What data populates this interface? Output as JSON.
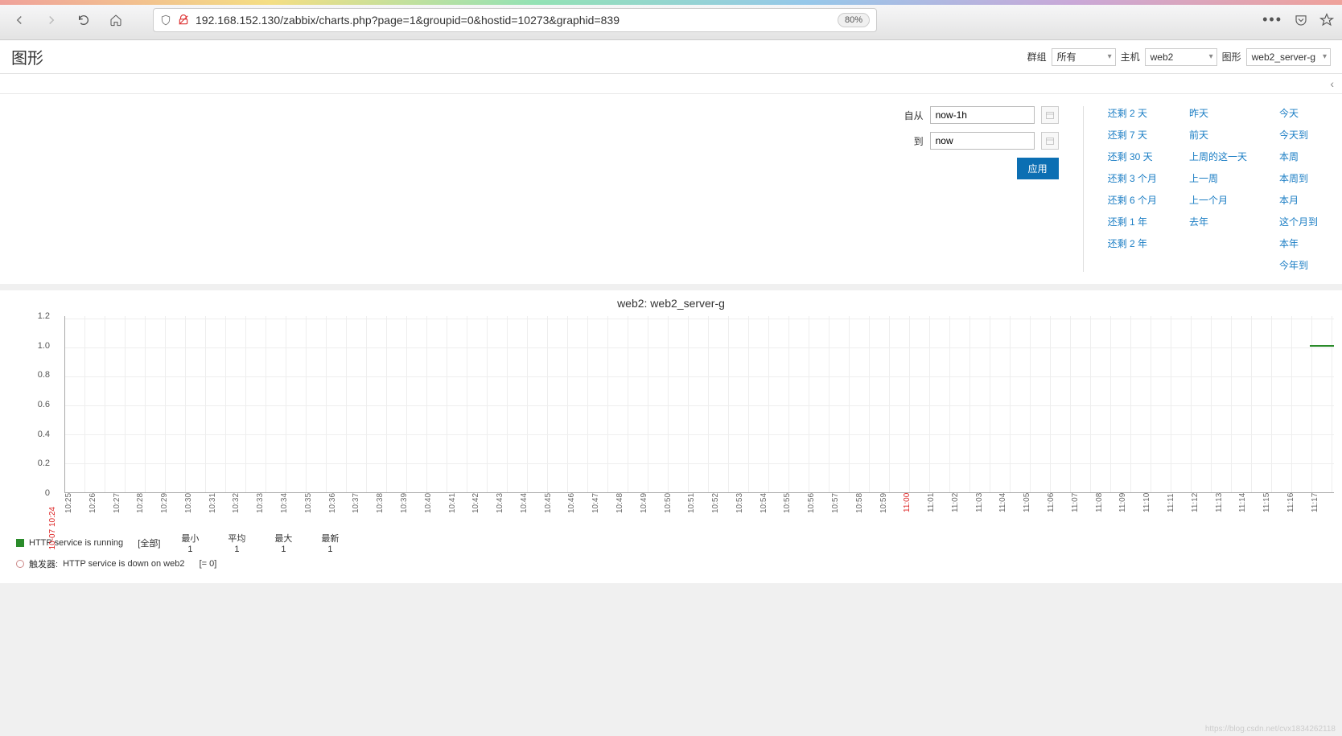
{
  "browser": {
    "url": "192.168.152.130/zabbix/charts.php?page=1&groupid=0&hostid=10273&graphid=839",
    "zoom": "80%"
  },
  "header": {
    "title": "图形",
    "filters": {
      "group_label": "群组",
      "group_value": "所有",
      "host_label": "主机",
      "host_value": "web2",
      "graph_label": "图形",
      "graph_value": "web2_server-g"
    }
  },
  "time": {
    "from_label": "自从",
    "from_value": "now-1h",
    "to_label": "到",
    "to_value": "now",
    "apply_label": "应用",
    "quick": {
      "col1": [
        "还剩 2 天",
        "还剩 7 天",
        "还剩 30 天",
        "还剩 3 个月",
        "还剩 6 个月",
        "还剩 1 年",
        "还剩 2 年"
      ],
      "col2": [
        "昨天",
        "前天",
        "上周的这一天",
        "上一周",
        "上一个月",
        "去年"
      ],
      "col3": [
        "今天",
        "今天到",
        "本周",
        "本周到",
        "本月",
        "这个月到",
        "本年",
        "今年到"
      ]
    }
  },
  "chart_data": {
    "type": "line",
    "title": "web2: web2_server-g",
    "ylabel": "",
    "ylim": [
      0,
      1.2
    ],
    "y_ticks": [
      0,
      0.2,
      0.4,
      0.6,
      0.8,
      1.0,
      1.2
    ],
    "x_start": "10-07 10:24",
    "x_ticks": [
      "10:25",
      "10:26",
      "10:27",
      "10:28",
      "10:29",
      "10:30",
      "10:31",
      "10:32",
      "10:33",
      "10:34",
      "10:35",
      "10:36",
      "10:37",
      "10:38",
      "10:39",
      "10:40",
      "10:41",
      "10:42",
      "10:43",
      "10:44",
      "10:45",
      "10:46",
      "10:47",
      "10:48",
      "10:49",
      "10:50",
      "10:51",
      "10:52",
      "10:53",
      "10:54",
      "10:55",
      "10:56",
      "10:57",
      "10:58",
      "10:59",
      "11:00",
      "11:01",
      "11:02",
      "11:03",
      "11:04",
      "11:05",
      "11:06",
      "11:07",
      "11:08",
      "11:09",
      "11:10",
      "11:11",
      "11:12",
      "11:13",
      "11:14",
      "11:15",
      "11:16",
      "11:17"
    ],
    "x_red_index": 35,
    "series": [
      {
        "name": "HTTP service is running",
        "color": "#2a8b2a",
        "values_note": "value 1 appears near ~11:16-11:17",
        "last_value": 1
      }
    ],
    "triggers": [
      {
        "name": "HTTP service is down on web2",
        "condition": "[= 0]"
      }
    ],
    "legend_stats_header": [
      "最小",
      "平均",
      "最大",
      "最新"
    ],
    "legend_stats_values": [
      "1",
      "1",
      "1",
      "1"
    ],
    "legend_series_label": "HTTP service is running",
    "legend_series_suffix": "[全部]",
    "legend_trigger_prefix": "触发器:",
    "legend_trigger_text": "HTTP service is down on web2",
    "legend_trigger_cond": "[= 0]"
  },
  "watermark": "https://blog.csdn.net/cvx1834262118"
}
